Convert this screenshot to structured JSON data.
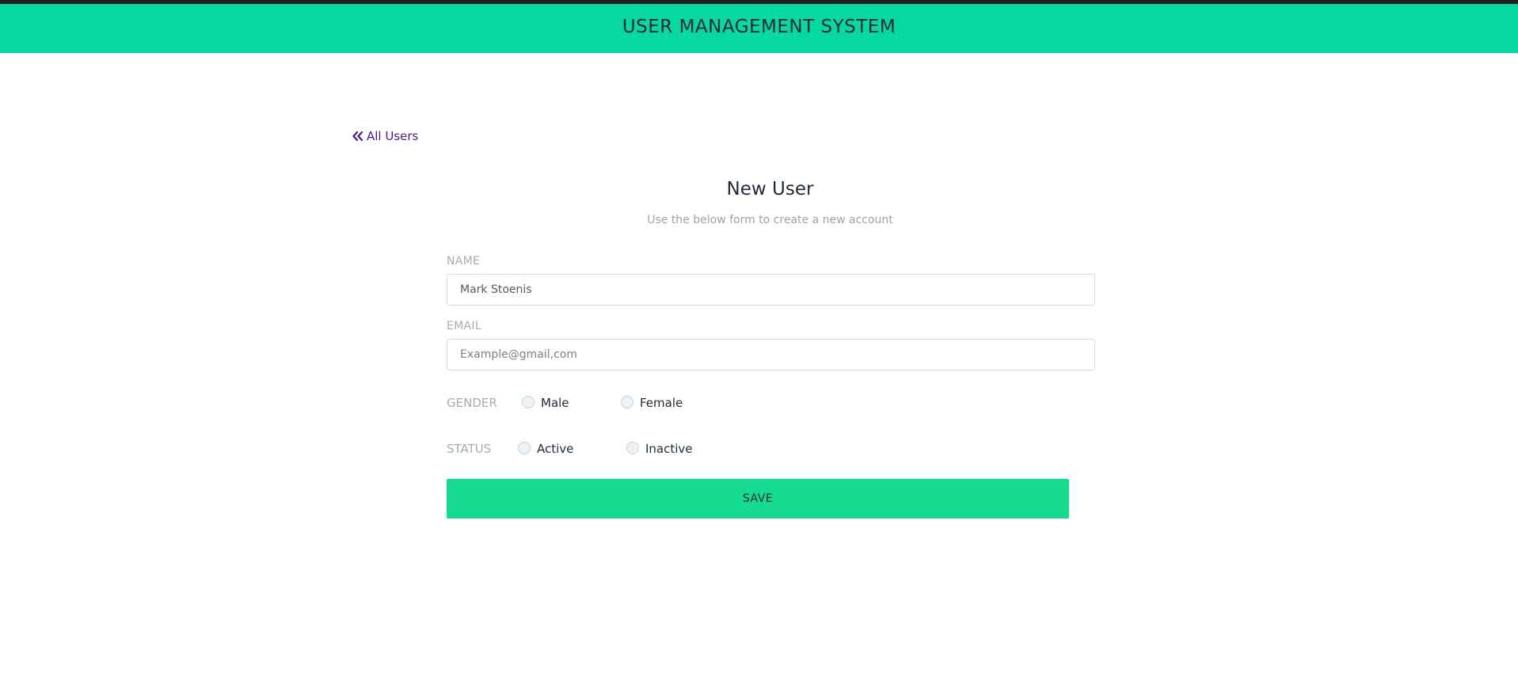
{
  "header": {
    "title": "USER MANAGEMENT SYSTEM"
  },
  "nav": {
    "back_label": "All Users",
    "back_icon": "double-chevron-left-icon"
  },
  "form": {
    "title": "New User",
    "subtitle": "Use the below form to create a new account",
    "name": {
      "label": "NAME",
      "value": "Mark Stoenis",
      "placeholder": ""
    },
    "email": {
      "label": "EMAIL",
      "value": "",
      "placeholder": "Example@gmail,com"
    },
    "gender": {
      "label": "GENDER",
      "options": [
        "Male",
        "Female"
      ],
      "selected": null
    },
    "status": {
      "label": "STATUS",
      "options": [
        "Active",
        "Inactive"
      ],
      "selected": null
    },
    "save_label": "SAVE"
  },
  "colors": {
    "header_bg": "#06d8a0",
    "save_bg": "#16da90",
    "link": "#4a1a8c"
  }
}
